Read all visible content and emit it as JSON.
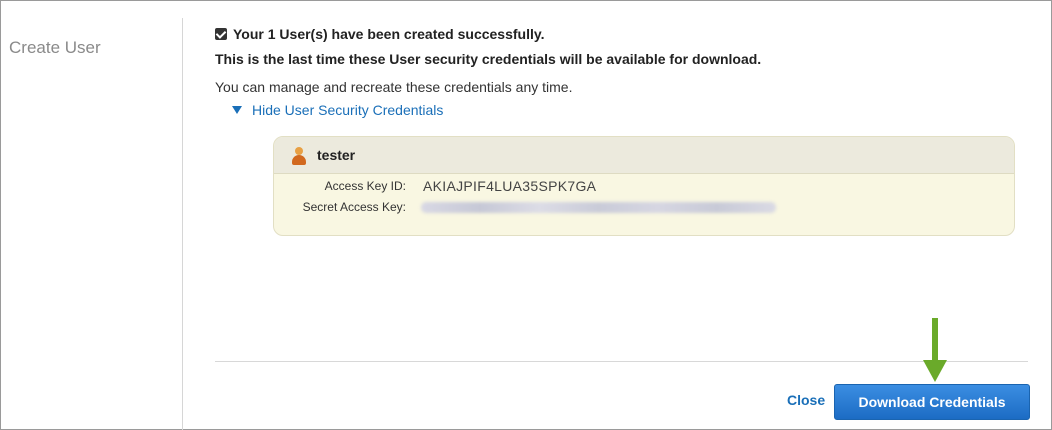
{
  "sidebar": {
    "title": "Create User"
  },
  "status": {
    "success_message": "Your 1 User(s) have been created successfully.",
    "warning_message": "This is the last time these User security credentials will be available for download.",
    "manage_message": "You can manage and recreate these credentials any time.",
    "toggle_label": "Hide User Security Credentials"
  },
  "credentials": {
    "username": "tester",
    "access_key_label": "Access Key ID:",
    "access_key_value": "AKIAJPIF4LUA35SPK7GA",
    "secret_key_label": "Secret Access Key:"
  },
  "footer": {
    "close_label": "Close",
    "download_label": "Download Credentials"
  },
  "icons": {
    "checkbox": "checkbox-checked-icon",
    "toggle": "triangle-down-icon",
    "user": "user-icon",
    "arrow": "arrow-down-icon"
  },
  "colors": {
    "link": "#1a6fb8",
    "button": "#1c6cc4",
    "box_background": "#f9f7e2",
    "arrow": "#6aaa2a"
  }
}
